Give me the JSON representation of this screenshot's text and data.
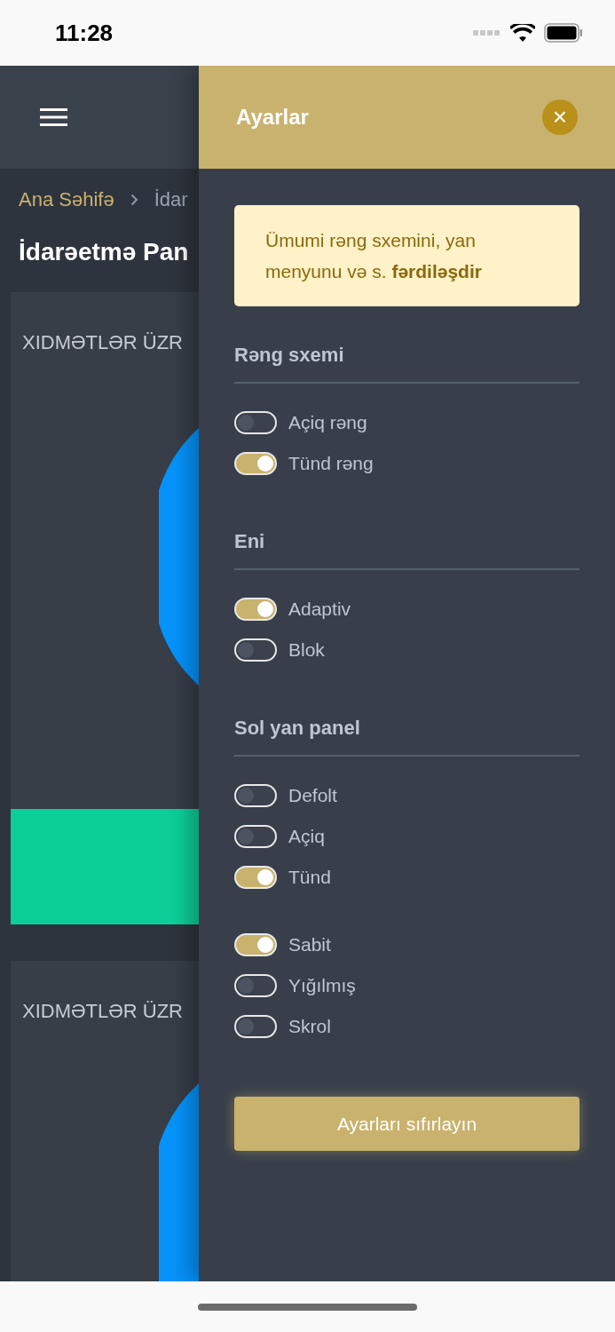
{
  "status_bar": {
    "time": "11:28"
  },
  "background_page": {
    "breadcrumb": [
      "Ana Səhifə",
      "İdar"
    ],
    "title": "İdarəetmə Pan",
    "cards": [
      {
        "title": "XIDMƏTLƏR ÜZR"
      },
      {
        "title": "XIDMƏTLƏR ÜZR"
      }
    ]
  },
  "settings_panel": {
    "title": "Ayarlar",
    "close": "×",
    "notice": "Ümumi rəng sxemini, yan menyunu və s. **fərdiləşdir**",
    "sections": [
      {
        "title": "Rəng sxemi",
        "groups": [
          [
            {
              "label": "Açiq rəng",
              "on": false
            },
            {
              "label": "Tünd rəng",
              "on": true
            }
          ]
        ]
      },
      {
        "title": "Eni",
        "groups": [
          [
            {
              "label": "Adaptiv",
              "on": true
            },
            {
              "label": "Blok",
              "on": false
            }
          ]
        ]
      },
      {
        "title": "Sol yan panel",
        "groups": [
          [
            {
              "label": "Defolt",
              "on": false
            },
            {
              "label": "Açiq",
              "on": false
            },
            {
              "label": "Tünd",
              "on": true
            }
          ],
          [
            {
              "label": "Sabit",
              "on": true
            },
            {
              "label": "Yığılmış",
              "on": false
            },
            {
              "label": "Skrol",
              "on": false
            }
          ]
        ]
      }
    ],
    "reset_button": "Ayarları sıfırlayın"
  }
}
